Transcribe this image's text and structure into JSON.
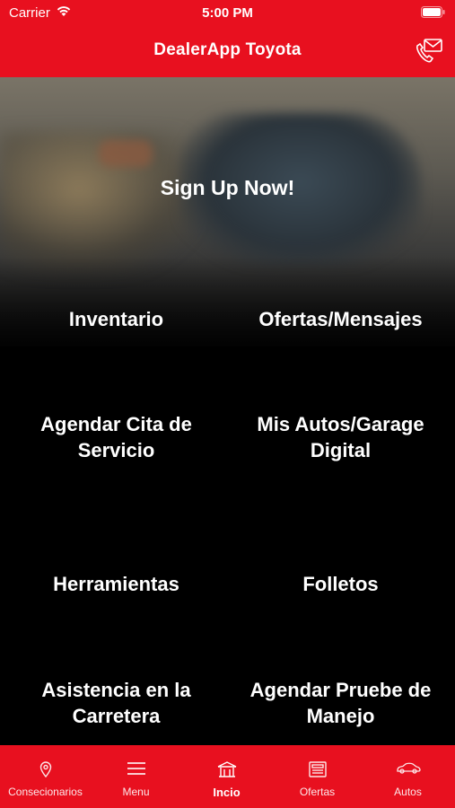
{
  "status_bar": {
    "carrier": "Carrier",
    "time": "5:00 PM"
  },
  "header": {
    "title": "DealerApp Toyota",
    "action_icon": "phone-mail-icon"
  },
  "hero": {
    "signup_label": "Sign Up Now!"
  },
  "menu_items": [
    {
      "label": "Inventario"
    },
    {
      "label": "Ofertas/Mensajes"
    },
    {
      "label": "Agendar Cita de Servicio"
    },
    {
      "label": "Mis Autos/Garage Digital"
    },
    {
      "label": "Herramientas"
    },
    {
      "label": "Folletos"
    },
    {
      "label": "Asistencia en la Carretera"
    },
    {
      "label": "Agendar Pruebe de Manejo"
    }
  ],
  "tabs": [
    {
      "label": "Consecionarios",
      "icon": "location-pin-icon"
    },
    {
      "label": "Menu",
      "icon": "hamburger-menu-icon"
    },
    {
      "label": "Incio",
      "icon": "dealership-building-icon",
      "active": true
    },
    {
      "label": "Ofertas",
      "icon": "newspaper-icon"
    },
    {
      "label": "Autos",
      "icon": "car-icon"
    }
  ],
  "colors": {
    "brand_red": "#e8101f",
    "background": "#000000",
    "text": "#ffffff"
  }
}
